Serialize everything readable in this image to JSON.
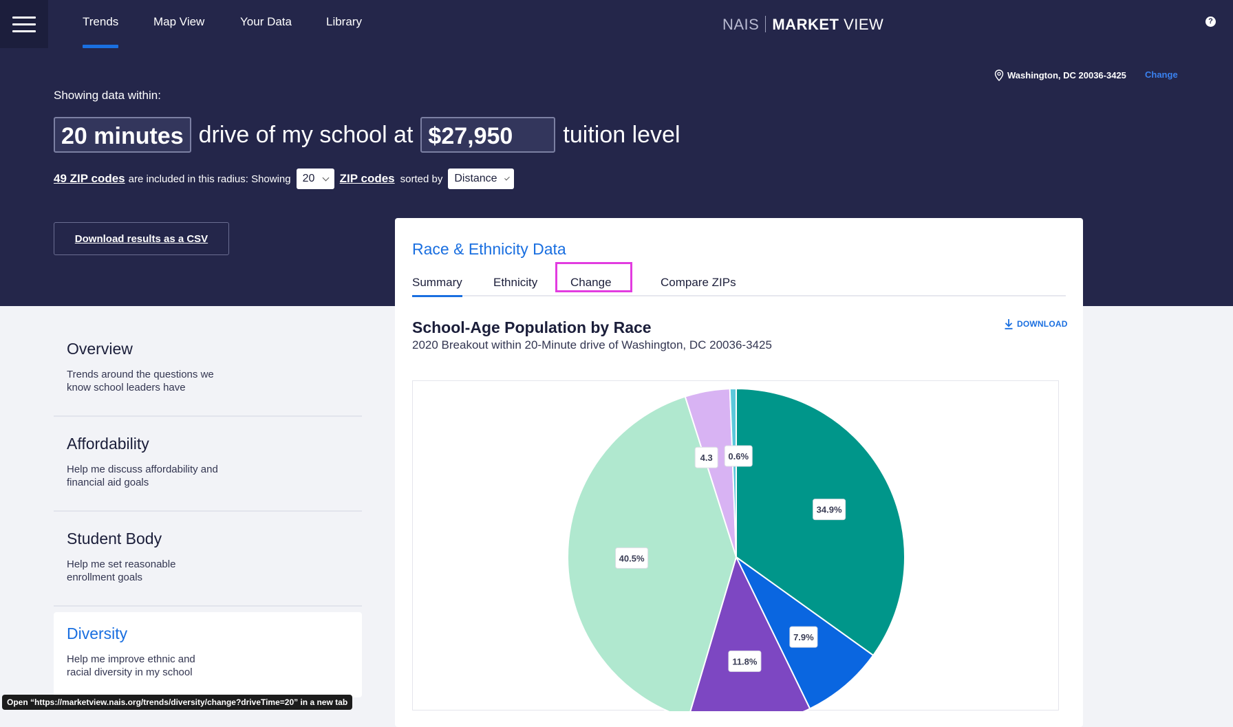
{
  "nav": {
    "tabs": [
      {
        "label": "Trends"
      },
      {
        "label": "Map View"
      },
      {
        "label": "Your Data"
      },
      {
        "label": "Library"
      }
    ],
    "brand_nais": "NAIS",
    "brand_market": "MARKET",
    "brand_view": "VIEW",
    "help_label": "?"
  },
  "location": {
    "text": "Washington, DC 20036-3425",
    "change_label": "Change"
  },
  "filters": {
    "showing_label": "Showing data within:",
    "drive_time": "20 minutes",
    "sentence_mid": "drive of my school at",
    "tuition": "$27,950",
    "sentence_end": "tuition level",
    "zip_count_link": "49 ZIP codes",
    "included_text": "are included in this radius: Showing",
    "show_count": "20",
    "zip_codes_link": "ZIP codes",
    "sorted_by_text": "sorted by",
    "sort_value": "Distance",
    "download_csv": "Download results as a CSV"
  },
  "sidebar": {
    "items": [
      {
        "title": "Overview",
        "desc": "Trends around the questions we know school leaders have"
      },
      {
        "title": "Affordability",
        "desc": "Help me discuss affordability and financial aid goals"
      },
      {
        "title": "Student Body",
        "desc": "Help me set reasonable enrollment goals"
      },
      {
        "title": "Diversity",
        "desc": "Help me improve ethnic and racial diversity in my school"
      }
    ]
  },
  "card": {
    "title": "Race & Ethnicity Data",
    "tabs": [
      {
        "label": "Summary"
      },
      {
        "label": "Ethnicity"
      },
      {
        "label": "Change"
      },
      {
        "label": "Compare ZIPs"
      }
    ],
    "download_label": "DOWNLOAD",
    "chart_title": "School-Age Population by Race",
    "chart_subtitle": "2020 Breakout within 20-Minute drive of Washington, DC 20036-3425"
  },
  "chart_data": {
    "type": "pie",
    "title": "School-Age Population by Race",
    "subtitle": "2020 Breakout within 20-Minute drive of Washington, DC 20036-3425",
    "slices": [
      {
        "value": 34.9,
        "label": "34.9%",
        "color": "#00968a"
      },
      {
        "value": 7.9,
        "label": "7.9%",
        "color": "#0a66e0"
      },
      {
        "value": 11.8,
        "label": "11.8%",
        "color": "#7d47c2"
      },
      {
        "value": 40.5,
        "label": "40.5%",
        "color": "#b0e8cf"
      },
      {
        "value": 4.3,
        "label": "4.3",
        "color": "#d8b3f3"
      },
      {
        "value": 0.6,
        "label": "0.6%",
        "color": "#5cc8db"
      }
    ]
  },
  "status_bar": {
    "text": "Open “https://marketview.nais.org/trends/diversity/change?driveTime=20” in a new tab"
  },
  "colors": {
    "hero_bg": "#24264a",
    "accent": "#1a6fe0",
    "highlight": "#e23ce0"
  }
}
